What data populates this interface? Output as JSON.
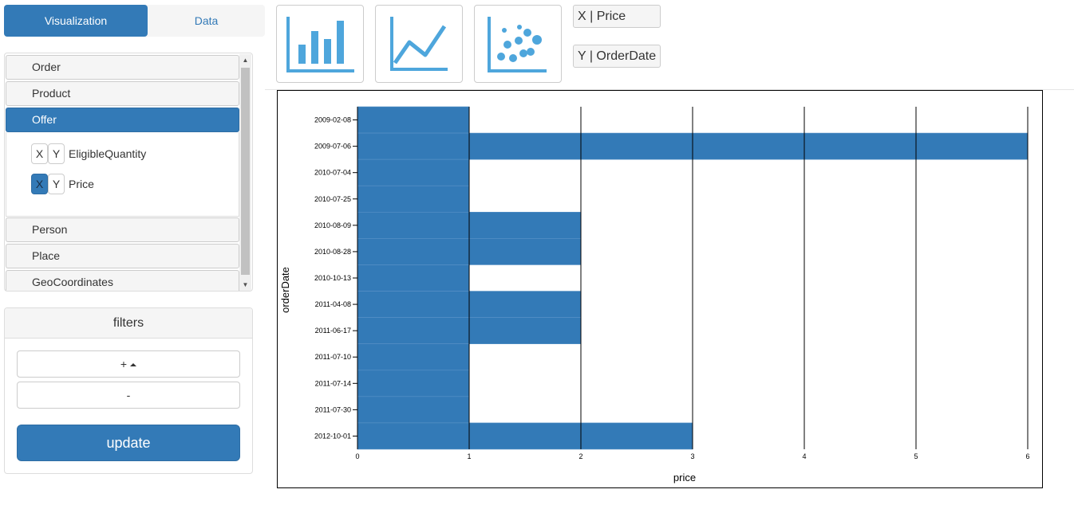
{
  "tabs": {
    "visualization": "Visualization",
    "data": "Data"
  },
  "accordion": {
    "sections": [
      "Order",
      "Product",
      "Offer",
      "Person",
      "Place",
      "GeoCoordinates"
    ],
    "open_section": "Offer",
    "attributes": [
      {
        "x": "X",
        "y": "Y",
        "name": "EligibleQuantity",
        "x_selected": false
      },
      {
        "x": "X",
        "y": "Y",
        "name": "Price",
        "x_selected": true
      }
    ]
  },
  "filters": {
    "title": "filters",
    "add_label": "+",
    "remove_label": "-",
    "update_label": "update"
  },
  "toolbar": {
    "chart_types": [
      "bar-chart-icon",
      "line-chart-icon",
      "scatter-chart-icon"
    ],
    "x_axis": "X | Price",
    "y_axis": "Y | OrderDate"
  },
  "colors": {
    "accent": "#337ab7",
    "icon_blue": "#4ea6dc"
  },
  "chart_data": {
    "type": "bar",
    "orientation": "horizontal",
    "categories": [
      "2009-02-08",
      "2009-07-06",
      "2010-07-04",
      "2010-07-25",
      "2010-08-09",
      "2010-08-28",
      "2010-10-13",
      "2011-04-08",
      "2011-06-17",
      "2011-07-10",
      "2011-07-14",
      "2011-07-30",
      "2012-10-01"
    ],
    "values": [
      1,
      6,
      1,
      1,
      2,
      2,
      1,
      2,
      2,
      1,
      1,
      1,
      3
    ],
    "xlabel": "price",
    "ylabel": "orderDate",
    "xlim": [
      0,
      6
    ],
    "xticks": [
      0,
      1,
      2,
      3,
      4,
      5,
      6
    ],
    "grid": true,
    "color": "#337ab7"
  }
}
